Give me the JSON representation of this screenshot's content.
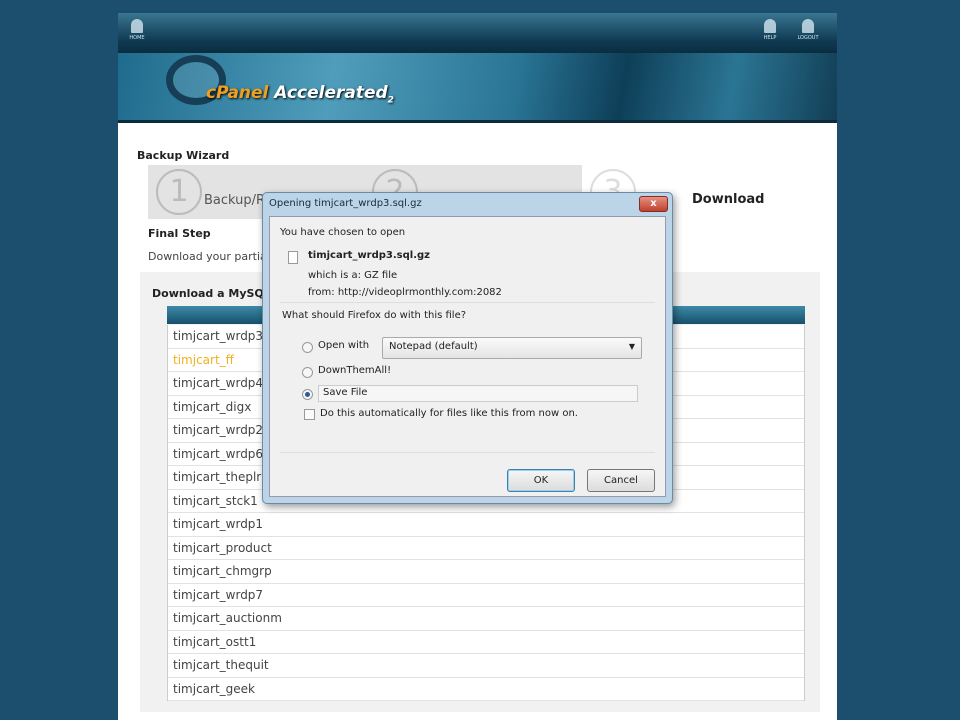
{
  "topbar": {
    "home": "HOME",
    "help": "HELP",
    "logout": "LOGOUT"
  },
  "banner": {
    "logo_c": "cPanel",
    "logo_rest": " Accelerated",
    "logo_sub": "2"
  },
  "wizard": {
    "title": "Backup Wizard",
    "steps": [
      {
        "num": "1",
        "label": "Backup/Restore"
      },
      {
        "num": "2",
        "label": ""
      },
      {
        "num": "3",
        "label": "Download"
      }
    ],
    "final_title": "Final Step",
    "final_desc": "Download your partial backups",
    "section_title": "Download a MySQL Database Backup",
    "databases": [
      "timjcart_wrdp3",
      "timjcart_ff",
      "timjcart_wrdp4",
      "timjcart_digx",
      "timjcart_wrdp2",
      "timjcart_wrdp6",
      "timjcart_theplr",
      "timjcart_stck1",
      "timjcart_wrdp1",
      "timjcart_product",
      "timjcart_chmgrp",
      "timjcart_wrdp7",
      "timjcart_auctionm",
      "timjcart_ostt1",
      "timjcart_thequit",
      "timjcart_geek"
    ]
  },
  "dialog": {
    "title": "Opening timjcart_wrdp3.sql.gz",
    "intro": "You have chosen to open",
    "filename": "timjcart_wrdp3.sql.gz",
    "type_label": "which is a:  GZ file",
    "from_label": "from:  http://videoplrmonthly.com:2082",
    "question": "What should Firefox do with this file?",
    "open_with": "Open with",
    "app": "Notepad (default)",
    "downthemall": "DownThemAll!",
    "save_file": "Save File",
    "auto": "Do this automatically for files like this from now on.",
    "ok": "OK",
    "cancel": "Cancel",
    "close": "x"
  }
}
